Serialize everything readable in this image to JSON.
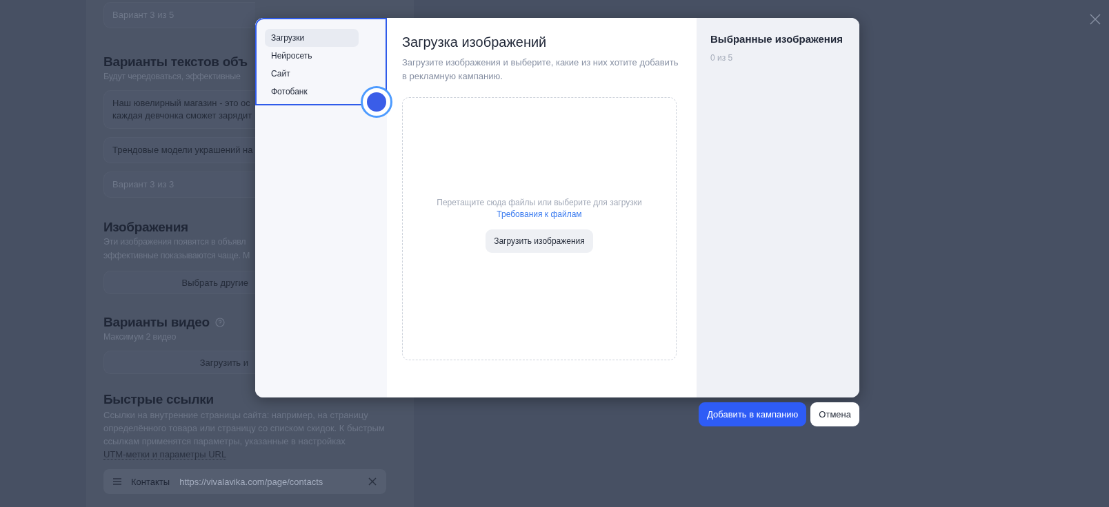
{
  "form": {
    "top_field": {
      "text": "Вариант 3 из 5",
      "kind": "placeholder"
    },
    "text_variants": {
      "title": "Варианты текстов объ",
      "subtitle": "Будут чередоваться, эффективные",
      "fields": [
        {
          "kind": "value",
          "lines": [
            "Наш ювелирный магазин - это ос",
            "каждая девчонка сможет зарядит"
          ]
        },
        {
          "kind": "value",
          "lines": [
            "Трендовые модели украшений на"
          ]
        },
        {
          "kind": "placeholder",
          "lines": [
            "Вариант 3 из 3"
          ]
        }
      ]
    },
    "images": {
      "title": "Изображения",
      "subtitle_lines": [
        "Эти изображения появятся в объявл",
        "эффективные показываются чаще. М"
      ],
      "button": "Выбрать другие"
    },
    "videos": {
      "title": "Варианты видео",
      "subtitle": "Максимум 2 видео",
      "button": "Загрузить и"
    },
    "quick_links": {
      "title": "Быстрые ссылки",
      "description": "Ссылки на внутренние страницы сайта: например, на страницу определённого товара или страницу со списком скидок. К быстрым ссылкам применятся параметры, указанные в настройках",
      "description_link": "UTM-метки и параметры URL",
      "links": [
        {
          "name": "Контакты",
          "url": "https://vivalavika.com/page/contacts"
        }
      ]
    }
  },
  "dialog": {
    "nav": [
      {
        "label": "Загрузки",
        "selected": true
      },
      {
        "label": "Нейросеть",
        "selected": false
      },
      {
        "label": "Сайт",
        "selected": false
      },
      {
        "label": "Фотобанк",
        "selected": false
      }
    ],
    "title": "Загрузка изображений",
    "subtitle": "Загрузите изображения и выберите, какие из них хотите добавить в рекламную кампанию.",
    "dropzone": {
      "hint": "Перетащите сюда файлы или выберите для загрузки",
      "link": "Требования к файлам",
      "button": "Загрузить изображения"
    },
    "selected_panel": {
      "title": "Выбранные изображения",
      "count": "0 из 5"
    },
    "buttons": [
      {
        "label": "Добавить в кампанию",
        "kind": "primary"
      },
      {
        "label": "Отмена",
        "kind": "secondary"
      }
    ]
  }
}
